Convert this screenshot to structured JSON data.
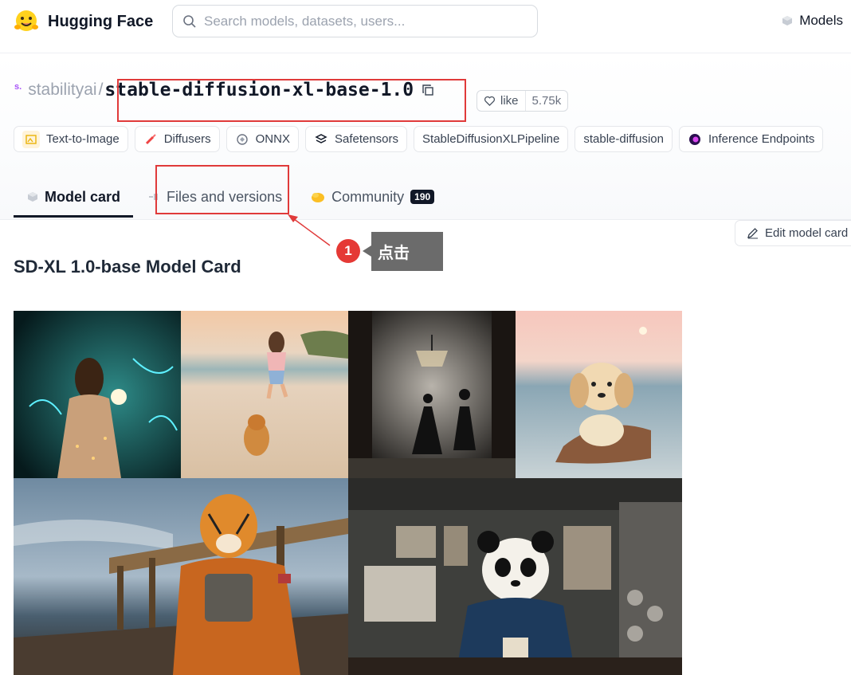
{
  "navbar": {
    "brand": "Hugging Face",
    "search_placeholder": "Search models, datasets, users...",
    "models_label": "Models"
  },
  "model": {
    "org": "stabilityai",
    "separator": "/",
    "name": "stable-diffusion-xl-base-1.0",
    "like_label": "like",
    "like_count": "5.75k"
  },
  "tags": [
    {
      "label": "Text-to-Image",
      "icon": "text-to-image-icon"
    },
    {
      "label": "Diffusers",
      "icon": "diffusers-icon"
    },
    {
      "label": "ONNX",
      "icon": "onnx-icon"
    },
    {
      "label": "Safetensors",
      "icon": "safetensors-icon"
    },
    {
      "label": "StableDiffusionXLPipeline",
      "icon": ""
    },
    {
      "label": "stable-diffusion",
      "icon": ""
    },
    {
      "label": "Inference Endpoints",
      "icon": "inference-endpoints-icon"
    }
  ],
  "tabs": [
    {
      "label": "Model card",
      "active": true,
      "icon": "cube-icon"
    },
    {
      "label": "Files and versions",
      "active": false,
      "icon": "files-icon"
    },
    {
      "label": "Community",
      "active": false,
      "icon": "community-icon",
      "badge": "190"
    }
  ],
  "edit_button": "Edit model card",
  "annotation": {
    "number": "1",
    "text": "点击",
    "color": "#e53935"
  },
  "card_title": "SD-XL 1.0-base Model Card",
  "colors": {
    "highlight": "#e03a3a",
    "accent": "#111827"
  }
}
